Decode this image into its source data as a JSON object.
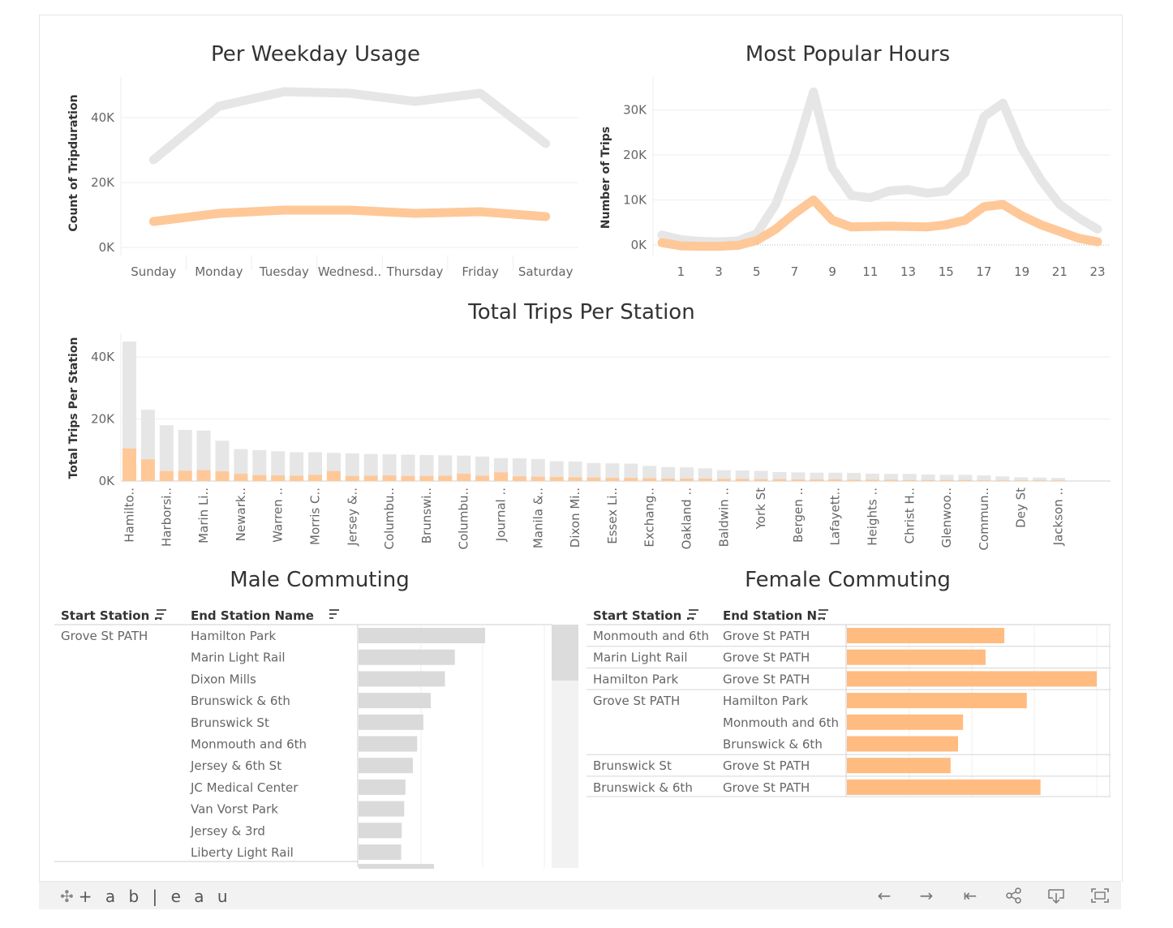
{
  "weekday": {
    "title": "Per Weekday Usage",
    "ylabel": "Count of Tripduration",
    "yticks": [
      "0K",
      "20K",
      "40K"
    ]
  },
  "hours": {
    "title": "Most Popular Hours",
    "ylabel": "Number of Trips",
    "yticks": [
      "0K",
      "10K",
      "20K",
      "30K"
    ]
  },
  "stations": {
    "title": "Total Trips Per Station",
    "ylabel": "Total Trips Per Station",
    "yticks": [
      "0K",
      "20K",
      "40K"
    ]
  },
  "male": {
    "title": "Male Commuting",
    "col1": "Start Station ..",
    "col2": "End Station Name",
    "start_station": "Grove St PATH",
    "rows": [
      {
        "end": "Hamilton Park",
        "value": 2050
      },
      {
        "end": "Marin Light Rail",
        "value": 1560
      },
      {
        "end": "Dixon Mills",
        "value": 1400
      },
      {
        "end": "Brunswick & 6th",
        "value": 1170
      },
      {
        "end": "Brunswick St",
        "value": 1050
      },
      {
        "end": "Monmouth and 6th",
        "value": 950
      },
      {
        "end": "Jersey & 6th St",
        "value": 880
      },
      {
        "end": "JC Medical Center",
        "value": 760
      },
      {
        "end": "Van Vorst Park",
        "value": 740
      },
      {
        "end": "Jersey & 3rd",
        "value": 700
      },
      {
        "end": "Liberty Light Rail",
        "value": 690
      }
    ]
  },
  "female": {
    "title": "Female Commuting",
    "col1": "Start Station ..",
    "col2": "End Station N..",
    "rows": [
      {
        "start": "Monmouth and 6th",
        "end": "Grove St PATH",
        "value": 630
      },
      {
        "start": "Marin Light Rail",
        "end": "Grove St PATH",
        "value": 555
      },
      {
        "start": "Hamilton Park",
        "end": "Grove St PATH",
        "value": 1000
      },
      {
        "start": "Grove St PATH",
        "end": "Hamilton Park",
        "value": 720
      },
      {
        "start": "",
        "end": "Monmouth and 6th",
        "value": 465
      },
      {
        "start": "",
        "end": "Brunswick & 6th",
        "value": 445
      },
      {
        "start": "Brunswick St",
        "end": "Grove St PATH",
        "value": 415
      },
      {
        "start": "Brunswick & 6th",
        "end": "Grove St PATH",
        "value": 775
      }
    ]
  },
  "colors": {
    "total": "#e6e6e6",
    "female": "#ffc898",
    "female_bar": "#ffbb80",
    "male_bar": "#dadada",
    "grid": "#eeeeee"
  },
  "toolbar": {
    "logo": "+ a b | e a u",
    "back_icon": "arrow-left-icon",
    "forward_icon": "arrow-right-icon",
    "reset_icon": "reset-icon",
    "share_icon": "share-icon",
    "download_icon": "download-icon",
    "fullscreen_icon": "fullscreen-icon"
  },
  "chart_data": [
    {
      "type": "line",
      "title": "Per Weekday Usage",
      "ylabel": "Count of Tripduration",
      "xlabel": "",
      "categories": [
        "Sunday",
        "Monday",
        "Tuesday",
        "Wednesd..",
        "Thursday",
        "Friday",
        "Saturday"
      ],
      "ylim": [
        0,
        48000
      ],
      "series": [
        {
          "values": [
            27000,
            43500,
            48000,
            47500,
            45000,
            47500,
            32000
          ]
        },
        {
          "values": [
            8000,
            10500,
            11500,
            11500,
            10500,
            11000,
            9500
          ]
        }
      ]
    },
    {
      "type": "line",
      "title": "Most Popular Hours",
      "ylabel": "Number of Trips",
      "xlabel": "",
      "x": [
        0,
        1,
        2,
        3,
        4,
        5,
        6,
        7,
        8,
        9,
        10,
        11,
        12,
        13,
        14,
        15,
        16,
        17,
        18,
        19,
        20,
        21,
        22,
        23
      ],
      "xticks": [
        1,
        3,
        5,
        7,
        9,
        11,
        13,
        15,
        17,
        19,
        21,
        23
      ],
      "ylim": [
        -2000,
        35000
      ],
      "series": [
        {
          "values": [
            2200,
            1200,
            800,
            700,
            900,
            2500,
            9000,
            20000,
            34000,
            17000,
            11000,
            10500,
            12000,
            12300,
            11500,
            12000,
            16000,
            28500,
            31500,
            21500,
            14500,
            9000,
            6000,
            3500
          ]
        },
        {
          "values": [
            500,
            -200,
            -300,
            -300,
            -100,
            1000,
            3500,
            7000,
            10000,
            5500,
            4000,
            4100,
            4200,
            4100,
            4000,
            4500,
            5500,
            8500,
            9000,
            6500,
            4500,
            3000,
            1500,
            700
          ]
        }
      ]
    },
    {
      "type": "bar",
      "title": "Total Trips Per Station",
      "ylabel": "Total Trips Per Station",
      "xlabel": "",
      "ylim": [
        0,
        45000
      ],
      "categories": [
        "Hamilto..",
        "",
        "Harborsi..",
        "",
        "Marin Li..",
        "",
        "Newark..",
        "",
        "Warren ..",
        "",
        "Morris C..",
        "",
        "Jersey &..",
        "",
        "Columbu..",
        "",
        "Brunswi..",
        "",
        "Columbu..",
        "",
        "Journal ..",
        "",
        "Manila &..",
        "",
        "Dixon Mi..",
        "",
        "Essex Li..",
        "",
        "Exchang..",
        "",
        "Oakland ..",
        "",
        "Baldwin ..",
        "",
        "York St",
        "",
        "Bergen ..",
        "",
        "Lafayett..",
        "",
        "Heights ..",
        "",
        "Christ H..",
        "",
        "Glenwoo..",
        "",
        "Commun..",
        "",
        "Dey St",
        "",
        "Jackson .."
      ],
      "series": [
        {
          "values": [
            45000,
            23000,
            18000,
            16500,
            16300,
            13000,
            10300,
            10000,
            9600,
            9300,
            9300,
            9100,
            8900,
            8700,
            8600,
            8500,
            8400,
            8300,
            8200,
            7900,
            7400,
            7300,
            7100,
            6400,
            6300,
            5800,
            5700,
            5600,
            4900,
            4500,
            4400,
            4100,
            3500,
            3400,
            3300,
            2900,
            2800,
            2700,
            2700,
            2600,
            2400,
            2300,
            2300,
            2100,
            2000,
            2000,
            1800,
            1500,
            1200,
            1100,
            1000
          ]
        },
        {
          "values": [
            10500,
            7000,
            3200,
            3300,
            3500,
            3100,
            2300,
            1900,
            1800,
            1700,
            2000,
            3200,
            1600,
            1700,
            1800,
            1600,
            1600,
            1700,
            2300,
            1700,
            2800,
            1500,
            1400,
            1300,
            1200,
            1100,
            1000,
            1000,
            900,
            800,
            800,
            800,
            700,
            700,
            600,
            600,
            500,
            500,
            500,
            400,
            400,
            400,
            300,
            300,
            300,
            300,
            200,
            200,
            200,
            200,
            200
          ]
        }
      ]
    }
  ]
}
